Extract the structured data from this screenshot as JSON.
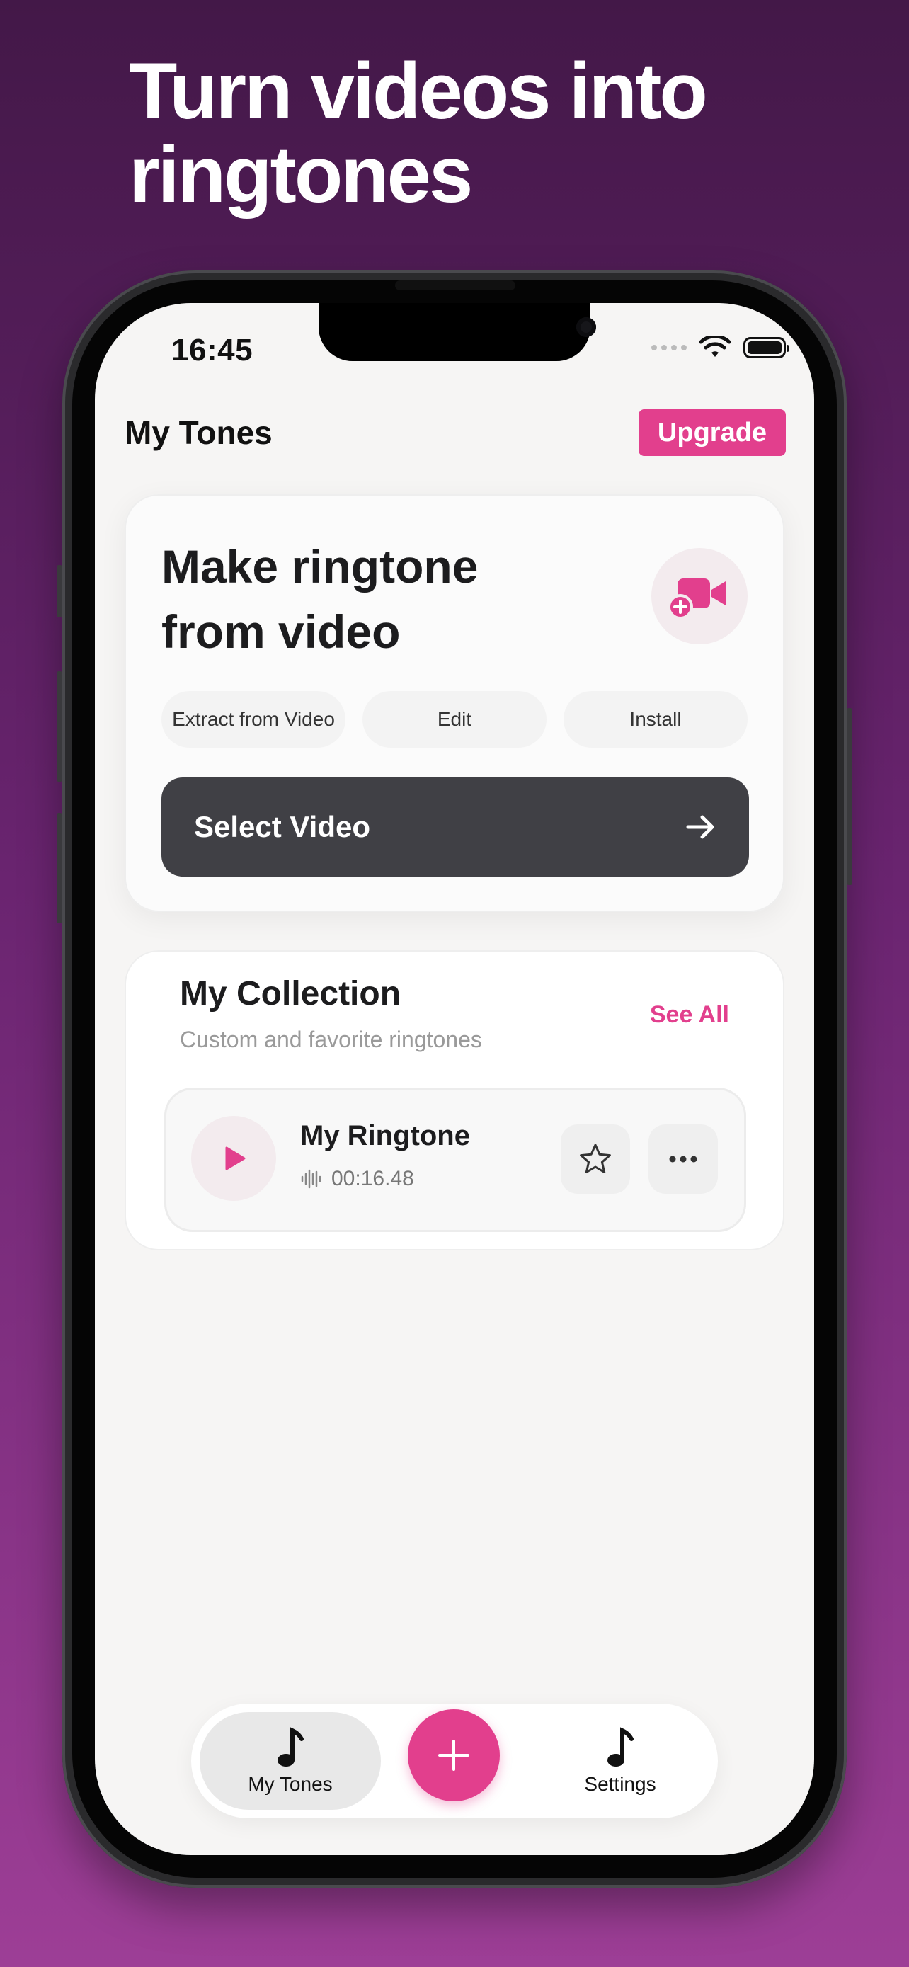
{
  "headline": "Turn videos into ringtones",
  "status_bar": {
    "time": "16:45"
  },
  "header": {
    "title": "My Tones",
    "upgrade_label": "Upgrade"
  },
  "make_card": {
    "title": "Make ringtone from video",
    "chips": [
      "Extract from Video",
      "Edit",
      "Install"
    ],
    "select_video_label": "Select Video"
  },
  "collection": {
    "title": "My Collection",
    "subtitle": "Custom and favorite ringtones",
    "see_all_label": "See All",
    "items": [
      {
        "name": "My Ringtone",
        "duration": "00:16.48"
      }
    ]
  },
  "tabbar": {
    "tabs": [
      {
        "label": "My Tones",
        "icon": "music-note-icon",
        "active": true
      },
      {
        "label": "Settings",
        "icon": "music-note-icon",
        "active": false
      }
    ],
    "fab_icon": "plus-icon"
  },
  "colors": {
    "accent": "#e23f8d",
    "dark_button": "#404045",
    "bg_top": "#431848",
    "bg_bottom": "#9d3e96"
  }
}
